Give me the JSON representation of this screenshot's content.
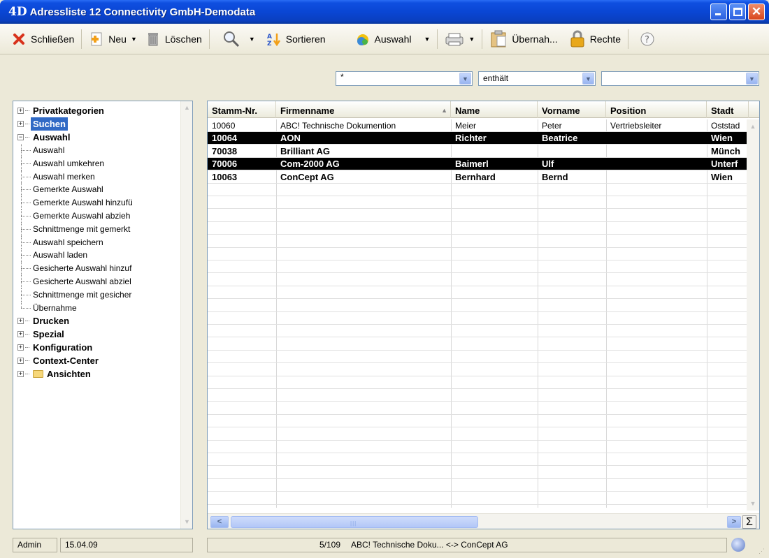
{
  "window": {
    "logo": "4D",
    "title": "Adressliste 12  Connectivity GmbH-Demodata"
  },
  "toolbar": {
    "close_label": "Schließen",
    "new_label": "Neu",
    "delete_label": "Löschen",
    "sort_label": "Sortieren",
    "selection_label": "Auswahl",
    "transfer_label": "Übernah...",
    "rights_label": "Rechte"
  },
  "filter": {
    "value": "*",
    "operator": "enthält",
    "field_value": ""
  },
  "tree": {
    "top_nodes": [
      {
        "label": "Privatkategorien",
        "expander": "+",
        "selected": false
      },
      {
        "label": "Suchen",
        "expander": "+",
        "selected": true
      },
      {
        "label": "Auswahl",
        "expander": "−",
        "selected": false
      }
    ],
    "auswahl_children": [
      "Auswahl",
      "Auswahl umkehren",
      "Auswahl merken",
      "Gemerkte Auswahl",
      "Gemerkte Auswahl hinzufü",
      "Gemerkte Auswahl abzieh",
      "Schnittmenge mit gemerkt",
      "Auswahl speichern",
      "Auswahl laden",
      "Gesicherte Auswahl hinzuf",
      "Gesicherte Auswahl abziel",
      "Schnittmenge mit gesicher",
      "Übernahme"
    ],
    "bottom_nodes": [
      {
        "label": "Drucken",
        "expander": "+"
      },
      {
        "label": "Spezial",
        "expander": "+"
      },
      {
        "label": "Konfiguration",
        "expander": "+"
      },
      {
        "label": "Context-Center",
        "expander": "+"
      },
      {
        "label": "Ansichten",
        "expander": "+",
        "folder": true
      }
    ]
  },
  "grid": {
    "columns": [
      "Stamm-Nr.",
      "Firmenname",
      "Name",
      "Vorname",
      "Position",
      "Stadt"
    ],
    "sorted_column": "Firmenname",
    "rows": [
      {
        "cells": [
          "10060",
          "ABC! Technische Dokumention",
          "Meier",
          "Peter",
          "Vertriebsleiter",
          "Oststad"
        ],
        "style": "normal"
      },
      {
        "cells": [
          "10064",
          "AON",
          "Richter",
          "Beatrice",
          "",
          "Wien"
        ],
        "style": "selected"
      },
      {
        "cells": [
          "70038",
          "Brilliant AG",
          "",
          "",
          "",
          "Münch"
        ],
        "style": "bold"
      },
      {
        "cells": [
          "70006",
          "Com-2000 AG",
          "Baimerl",
          "Ulf",
          "",
          "Unterf"
        ],
        "style": "selected"
      },
      {
        "cells": [
          "10063",
          "ConCept AG",
          "Bernhard",
          "Bernd",
          "",
          "Wien"
        ],
        "style": "bold"
      }
    ],
    "sum_symbol": "Σ"
  },
  "status": {
    "user": "Admin",
    "date": "15.04.09",
    "record_count": "5/109",
    "record_range": "ABC! Technische Doku... <-> ConCept AG"
  }
}
